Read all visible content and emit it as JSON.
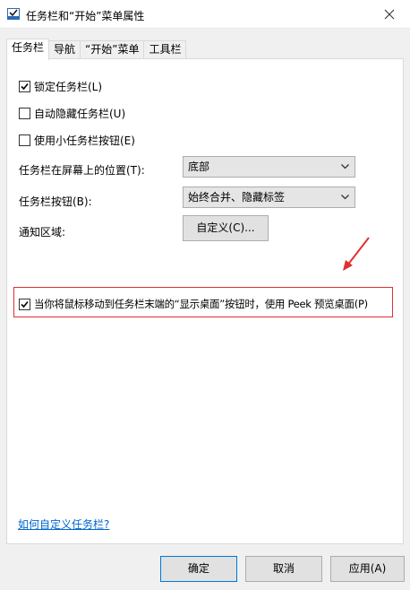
{
  "window": {
    "title": "任务栏和“开始”菜单属性",
    "close_label": "✕"
  },
  "tabs": [
    {
      "label": "任务栏",
      "active": true
    },
    {
      "label": "导航",
      "active": false
    },
    {
      "label": "“开始”菜单",
      "active": false
    },
    {
      "label": "工具栏",
      "active": false
    }
  ],
  "options": {
    "lock_taskbar": {
      "label": "锁定任务栏(L)",
      "checked": true
    },
    "auto_hide": {
      "label": "自动隐藏任务栏(U)",
      "checked": false
    },
    "small_buttons": {
      "label": "使用小任务栏按钮(E)",
      "checked": false
    },
    "peek": {
      "label": "当你将鼠标移动到任务栏末端的“显示桌面”按钮时，使用 Peek 预览桌面(P)",
      "checked": true
    }
  },
  "position": {
    "label": "任务栏在屏幕上的位置(T):",
    "value": "底部"
  },
  "buttons_setting": {
    "label": "任务栏按钮(B):",
    "value": "始终合并、隐藏标签"
  },
  "notification": {
    "label": "通知区域:",
    "button": "自定义(C)..."
  },
  "help_link": "如何自定义任务栏?",
  "footer": {
    "ok": "确定",
    "cancel": "取消",
    "apply": "应用(A)"
  },
  "colors": {
    "highlight_border": "#e0312f",
    "link": "#0066cc",
    "primary_border": "#0078d7"
  }
}
